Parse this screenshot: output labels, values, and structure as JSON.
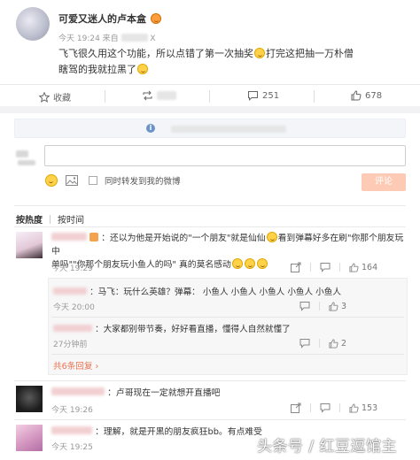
{
  "post": {
    "author": "可爱又迷人的卢本盒",
    "time": "今天 19:24 来自",
    "text_line1": "飞飞很久用这个功能，所以点错了第一次抽奖",
    "text_line1b": "打完这把抽一万朴僧",
    "text_line2": "瞎驾的我就拉黑了"
  },
  "actions": {
    "favorite": "收藏",
    "comment_count": "251",
    "like_count": "678"
  },
  "composer": {
    "forward_label": "同时转发到我的微博",
    "submit_label": "评论"
  },
  "sort": {
    "hot": "按热度",
    "time": "按时间"
  },
  "comments": [
    {
      "text_a": "：还以为他是开始说的\"一个朋友\"就是仙仙",
      "text_b": "看到弹幕好多在刷\"你那个朋友玩中",
      "text_c": "单吗\"\"你那个朋友玩小鱼人的吗\" 真的莫名感动",
      "time": "今天 19:29",
      "likes": "164"
    },
    {
      "text": "：马飞：玩什么英雄？弹幕： 小鱼人 小鱼人 小鱼人 小鱼人 小鱼人",
      "time": "今天 20:00",
      "likes": "3"
    },
    {
      "text": "：大家都别带节奏，好好看直播，懂得人自然就懂了",
      "time": "27分钟前",
      "likes": "2"
    },
    {
      "more": "共6条回复"
    },
    {
      "text": "：卢哥现在一定就想开直播吧",
      "time": "今天 19:26",
      "likes": "153"
    },
    {
      "text": "：理解，就是开黑的朋友疯狂bb。有点难受",
      "time": "今天 19:25",
      "likes": ""
    }
  ],
  "watermark": "头条号 / 红豆逗馆主"
}
